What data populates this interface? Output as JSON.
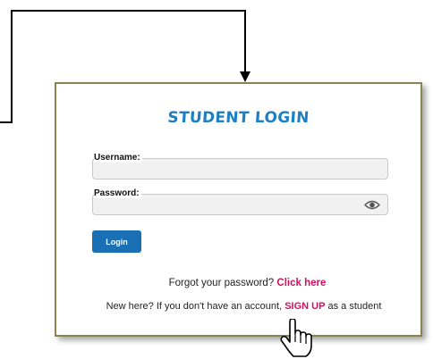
{
  "login": {
    "title": "STUDENT LOGIN",
    "username_label": "Username:",
    "username_value": "",
    "password_label": "Password:",
    "password_value": "",
    "login_button": "Login",
    "forgot_text": "Forgot your password?",
    "forgot_link": "Click here",
    "new_here_text": "New here? If you don't have an account,",
    "signup_link": "SIGN UP",
    "signup_suffix": "as a student"
  },
  "icons": {
    "password_toggle": "eye-icon",
    "pointer": "hand-pointer-icon"
  },
  "colors": {
    "title": "#1f7fc3",
    "button": "#1a6fb5",
    "link": "#d1105f",
    "panel_border": "#8a8350"
  }
}
